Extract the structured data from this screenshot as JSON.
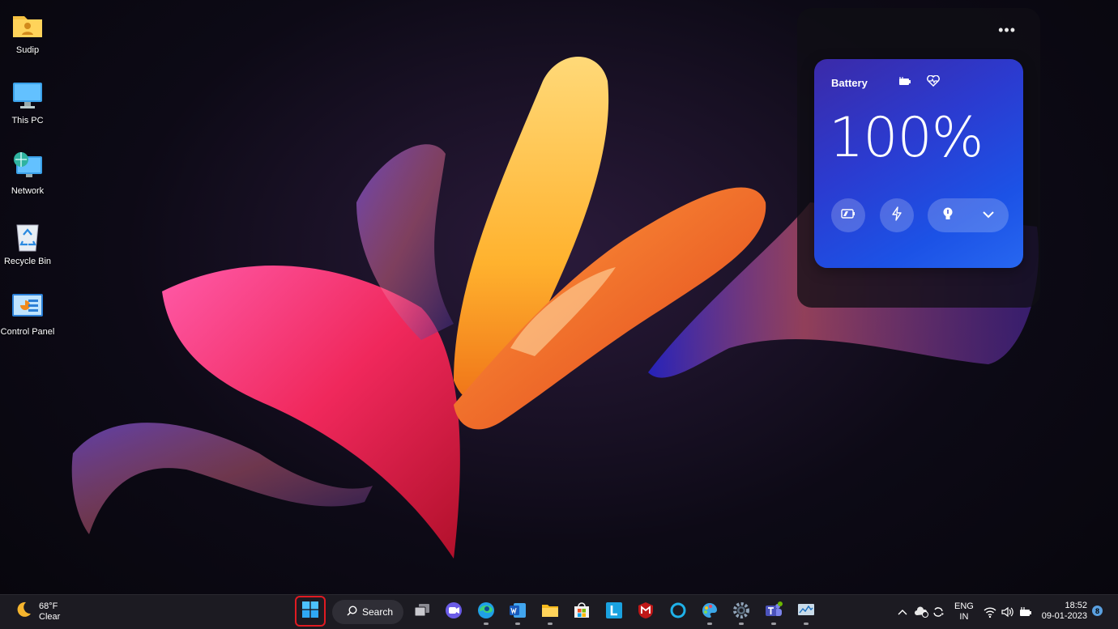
{
  "desktop": {
    "icons": [
      {
        "label": "Sudip",
        "icon": "user-folder-icon"
      },
      {
        "label": "This PC",
        "icon": "monitor-icon"
      },
      {
        "label": "Network",
        "icon": "network-globe-icon"
      },
      {
        "label": "Recycle Bin",
        "icon": "recycle-bin-icon"
      },
      {
        "label": "Control Panel",
        "icon": "control-panel-icon"
      }
    ]
  },
  "widget": {
    "more_label": "•••",
    "battery": {
      "title": "Battery",
      "percent": "100%",
      "level": 1.0,
      "accent": "#1c52e6"
    }
  },
  "taskbar": {
    "weather": {
      "temp": "68°F",
      "condition": "Clear"
    },
    "search_label": "Search",
    "apps": [
      "task-view",
      "chat",
      "edge",
      "word",
      "file-explorer",
      "store",
      "l-app",
      "mcafee",
      "cortana",
      "paint",
      "settings",
      "teams",
      "monitor-app"
    ],
    "language": {
      "line1": "ENG",
      "line2": "IN"
    },
    "clock": {
      "time": "18:52",
      "date": "09-01-2023"
    },
    "notifications": "8"
  },
  "colors": {
    "taskbar_bg": "#1c1b22",
    "start_highlight": "#e01b22"
  }
}
